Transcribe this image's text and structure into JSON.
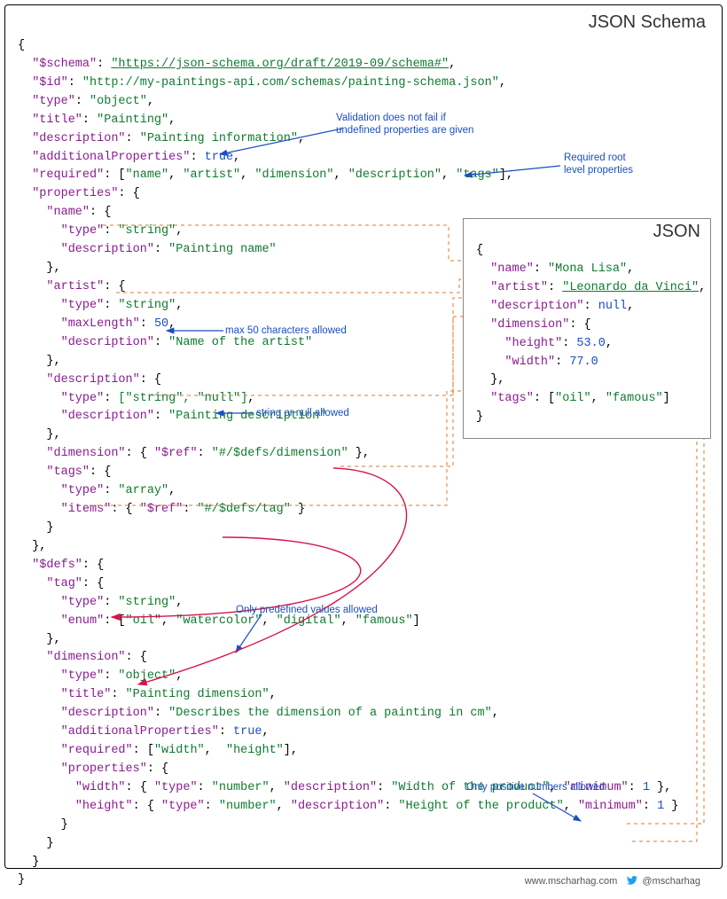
{
  "labels": {
    "schema_label": "JSON Schema",
    "json_label": "JSON"
  },
  "schema": {
    "key_schema": "\"$schema\"",
    "val_schema": "\"https://json-schema.org/draft/2019-09/schema#\"",
    "key_id": "\"$id\"",
    "val_id": "\"http://my-paintings-api.com/schemas/painting-schema.json\"",
    "key_type": "\"type\"",
    "val_object": "\"object\"",
    "key_title": "\"title\"",
    "val_title": "\"Painting\"",
    "key_desc": "\"description\"",
    "val_desc": "\"Painting information\"",
    "key_addprops": "\"additionalProperties\"",
    "val_true": "true",
    "key_required": "\"required\"",
    "req_name": "\"name\"",
    "req_artist": "\"artist\"",
    "req_dimension": "\"dimension\"",
    "req_desc": "\"description\"",
    "req_tags": "\"tags\"",
    "key_properties": "\"properties\"",
    "name_type": "\"string\"",
    "name_desc": "\"Painting name\"",
    "artist_type": "\"string\"",
    "artist_maxlen_key": "\"maxLength\"",
    "artist_maxlen": "50",
    "artist_desc": "\"Name of the artist\"",
    "descprop_types": "[\"string\", \"null\"]",
    "descprop_desc": "\"Painting description\"",
    "dim_ref": "\"#/$defs/dimension\"",
    "key_ref": "\"$ref\"",
    "tags_type": "\"array\"",
    "key_items": "\"items\"",
    "tag_ref": "\"#/$defs/tag\"",
    "key_defs": "\"$defs\"",
    "key_tag": "\"tag\"",
    "tag_type": "\"string\"",
    "key_enum": "\"enum\"",
    "enum_oil": "\"oil\"",
    "enum_water": "\"watercolor\"",
    "enum_digital": "\"digital\"",
    "enum_famous": "\"famous\"",
    "key_dim": "\"dimension\"",
    "dim_type": "\"object\"",
    "dim_title": "\"Painting dimension\"",
    "dim_desc": "\"Describes the dimension of a painting in cm\"",
    "dim_req_w": "\"width\"",
    "dim_req_h": "\"height\"",
    "key_width": "\"width\"",
    "key_height": "\"height\"",
    "key_number": "\"number\"",
    "width_desc": "\"Width of the product\"",
    "height_desc": "\"Height of the product\"",
    "key_min": "\"minimum\"",
    "val_one": "1"
  },
  "json": {
    "name_k": "\"name\"",
    "name_v": "\"Mona Lisa\"",
    "artist_k": "\"artist\"",
    "artist_v": "\"Leonardo da Vinci\"",
    "desc_k": "\"description\"",
    "desc_v": "null",
    "dim_k": "\"dimension\"",
    "height_k": "\"height\"",
    "height_v": "53.0",
    "width_k": "\"width\"",
    "width_v": "77.0",
    "tags_k": "\"tags\"",
    "tags_oil": "\"oil\"",
    "tags_famous": "\"famous\""
  },
  "annotations": {
    "a1": "Validation does not fail if\nundefined properties are given",
    "a2": "Required root\nlevel properties",
    "a3": "max 50 characters allowed",
    "a4": "string or null allowed",
    "a5": "Only predefined values allowed",
    "a6": "Only positive numbers allowed"
  },
  "credit": {
    "url": "www.mscharhag.com",
    "handle": "@mscharhag"
  }
}
